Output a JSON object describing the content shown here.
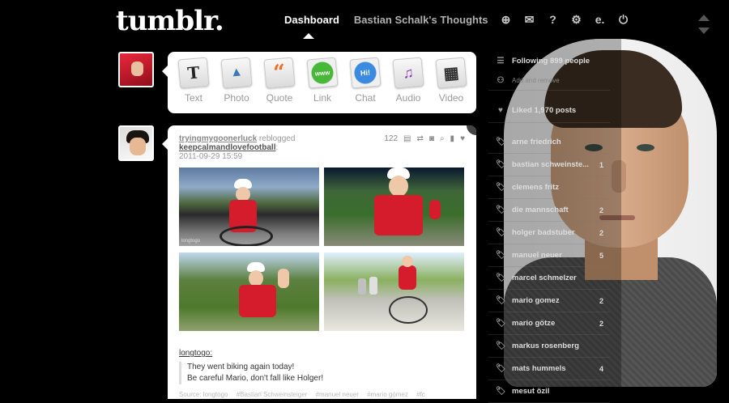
{
  "header": {
    "logo": "tumblr.",
    "nav_dashboard": "Dashboard",
    "nav_blog": "Bastian Schalk's Thoughts",
    "icons": [
      "plus-icon",
      "mail-icon",
      "help-icon",
      "gear-icon",
      "e-icon",
      "power-icon"
    ]
  },
  "post_types": [
    {
      "label": "Text",
      "glyph": "T"
    },
    {
      "label": "Photo",
      "glyph": "▲"
    },
    {
      "label": "Quote",
      "glyph": "“"
    },
    {
      "label": "Link",
      "glyph": "www"
    },
    {
      "label": "Chat",
      "glyph": "Hi!"
    },
    {
      "label": "Audio",
      "glyph": "♫"
    },
    {
      "label": "Video",
      "glyph": "▦"
    }
  ],
  "post": {
    "reblogger": "tryingmygoonerluck",
    "reblogged_text": "reblogged",
    "source_user": "keepcalmandlovefootball",
    "source_colon": ":",
    "date": "2011-09-29 15:59",
    "notes": "122",
    "photo_credit": "longtogo",
    "author": "longtogo",
    "author_colon": ":",
    "quote_line1": "They went biking again today!",
    "quote_line2": "Be careful Mario, don't fall like Holger!",
    "source_label": "Source: longtogo",
    "tags": [
      "#Bastian Schweinsteiger",
      "#manuel neuer",
      "#mario gómez",
      "#fc"
    ]
  },
  "sidebar": {
    "following": "Following 899 people",
    "add_remove": "Add and remove",
    "liked": "Liked 1,970 posts",
    "tags": [
      {
        "name": "arne friedrich",
        "count": ""
      },
      {
        "name": "bastian schweinste...",
        "count": "1"
      },
      {
        "name": "clemens fritz",
        "count": ""
      },
      {
        "name": "die mannschaft",
        "count": "2"
      },
      {
        "name": "holger badstuber",
        "count": "2"
      },
      {
        "name": "manuel neuer",
        "count": "5"
      },
      {
        "name": "marcel schmelzer",
        "count": ""
      },
      {
        "name": "mario gomez",
        "count": "2"
      },
      {
        "name": "mario götze",
        "count": "2"
      },
      {
        "name": "markus rosenberg",
        "count": ""
      },
      {
        "name": "mats hummels",
        "count": "4"
      },
      {
        "name": "mesut özil",
        "count": ""
      }
    ]
  }
}
